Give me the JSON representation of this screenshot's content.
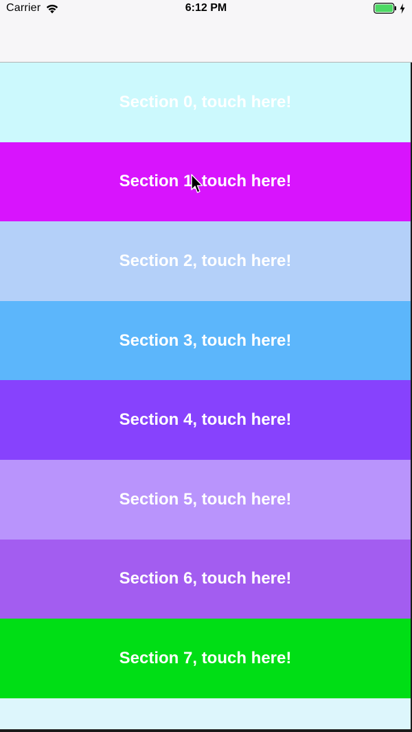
{
  "status_bar": {
    "carrier": "Carrier",
    "time": "6:12 PM",
    "battery_level": 1.0,
    "battery_color": "#4cd964",
    "charging": true
  },
  "sections": [
    {
      "label": "Section 0, touch here!",
      "color": "#ccf9fd"
    },
    {
      "label": "Section 1, touch here!",
      "color": "#d814fd"
    },
    {
      "label": "Section 2, touch here!",
      "color": "#b4d0f9"
    },
    {
      "label": "Section 3, touch here!",
      "color": "#5cb6fb"
    },
    {
      "label": "Section 4, touch here!",
      "color": "#8742fd"
    },
    {
      "label": "Section 5, touch here!",
      "color": "#b994fc"
    },
    {
      "label": "Section 6, touch here!",
      "color": "#a35df0"
    },
    {
      "label": "Section 7, touch here!",
      "color": "#00de15"
    }
  ],
  "section_tail": {
    "color": "#ddf6fc"
  },
  "icons": {
    "wifi": "wifi-icon",
    "battery": "battery-icon",
    "charging": "charging-bolt-icon",
    "cursor": "mouse-pointer-icon"
  }
}
